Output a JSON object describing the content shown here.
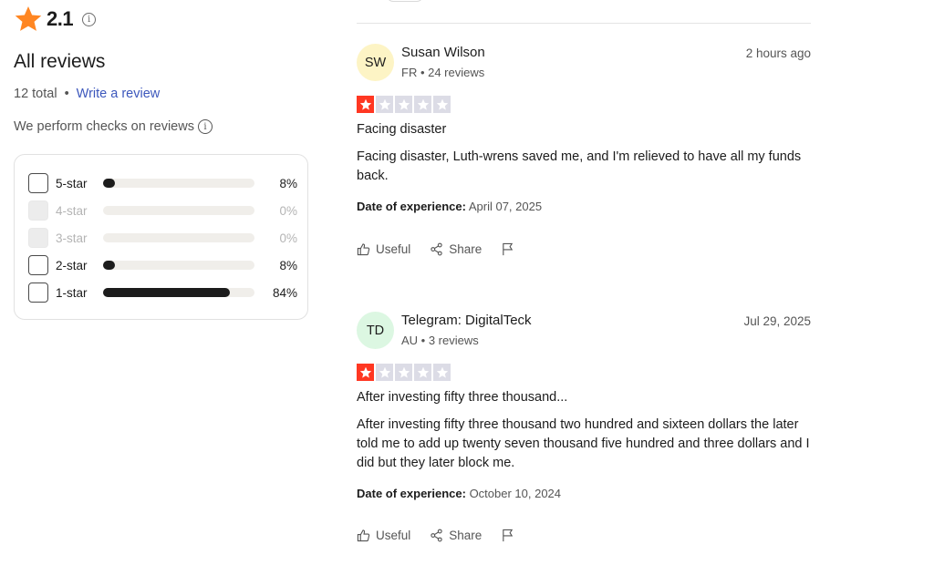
{
  "summary": {
    "rating": "2.1",
    "heading": "All reviews",
    "total": "12 total",
    "separator": "•",
    "write_review": "Write a review",
    "checks_text": "We perform checks on reviews",
    "info_glyph": "i"
  },
  "distribution": [
    {
      "label": "5-star",
      "percent": "8%",
      "fraction": 0.08,
      "enabled": true
    },
    {
      "label": "4-star",
      "percent": "0%",
      "fraction": 0.0,
      "enabled": false
    },
    {
      "label": "3-star",
      "percent": "0%",
      "fraction": 0.0,
      "enabled": false
    },
    {
      "label": "2-star",
      "percent": "8%",
      "fraction": 0.08,
      "enabled": true
    },
    {
      "label": "1-star",
      "percent": "84%",
      "fraction": 0.84,
      "enabled": true
    }
  ],
  "reviews": [
    {
      "initials": "SW",
      "avatar_color": "#fdf4c5",
      "name": "Susan Wilson",
      "meta": "FR • 24 reviews",
      "date": "2 hours ago",
      "stars": 1,
      "title": "Facing disaster",
      "body": "Facing disaster, Luth-wrens saved me, and I'm relieved to have all my funds back.",
      "experience_label": "Date of experience:",
      "experience_date": "April 07, 2025",
      "useful": "Useful",
      "share": "Share"
    },
    {
      "initials": "TD",
      "avatar_color": "#dcf7e2",
      "name": "Telegram: DigitalTeck",
      "meta": "AU • 3 reviews",
      "date": "Jul 29, 2025",
      "stars": 1,
      "title": "After investing fifty three thousand...",
      "body": "After investing fifty three thousand two hundred and sixteen dollars the later told me to add up twenty seven thousand five hundred and three dollars and I did but they later block me.",
      "experience_label": "Date of experience:",
      "experience_date": "October 10, 2024",
      "useful": "Useful",
      "share": "Share"
    }
  ],
  "colors": {
    "star_orange": "#ff8622",
    "star_red": "#ff3722",
    "star_empty": "#dcdce6",
    "link_blue": "#3c57bc",
    "bar_fill": "#1c1c1c",
    "bar_track": "#f0eeea"
  },
  "icons": {
    "rating_star": "star-icon",
    "info": "info-icon",
    "useful": "thumbs-up-icon",
    "share": "share-icon",
    "flag": "flag-icon"
  }
}
